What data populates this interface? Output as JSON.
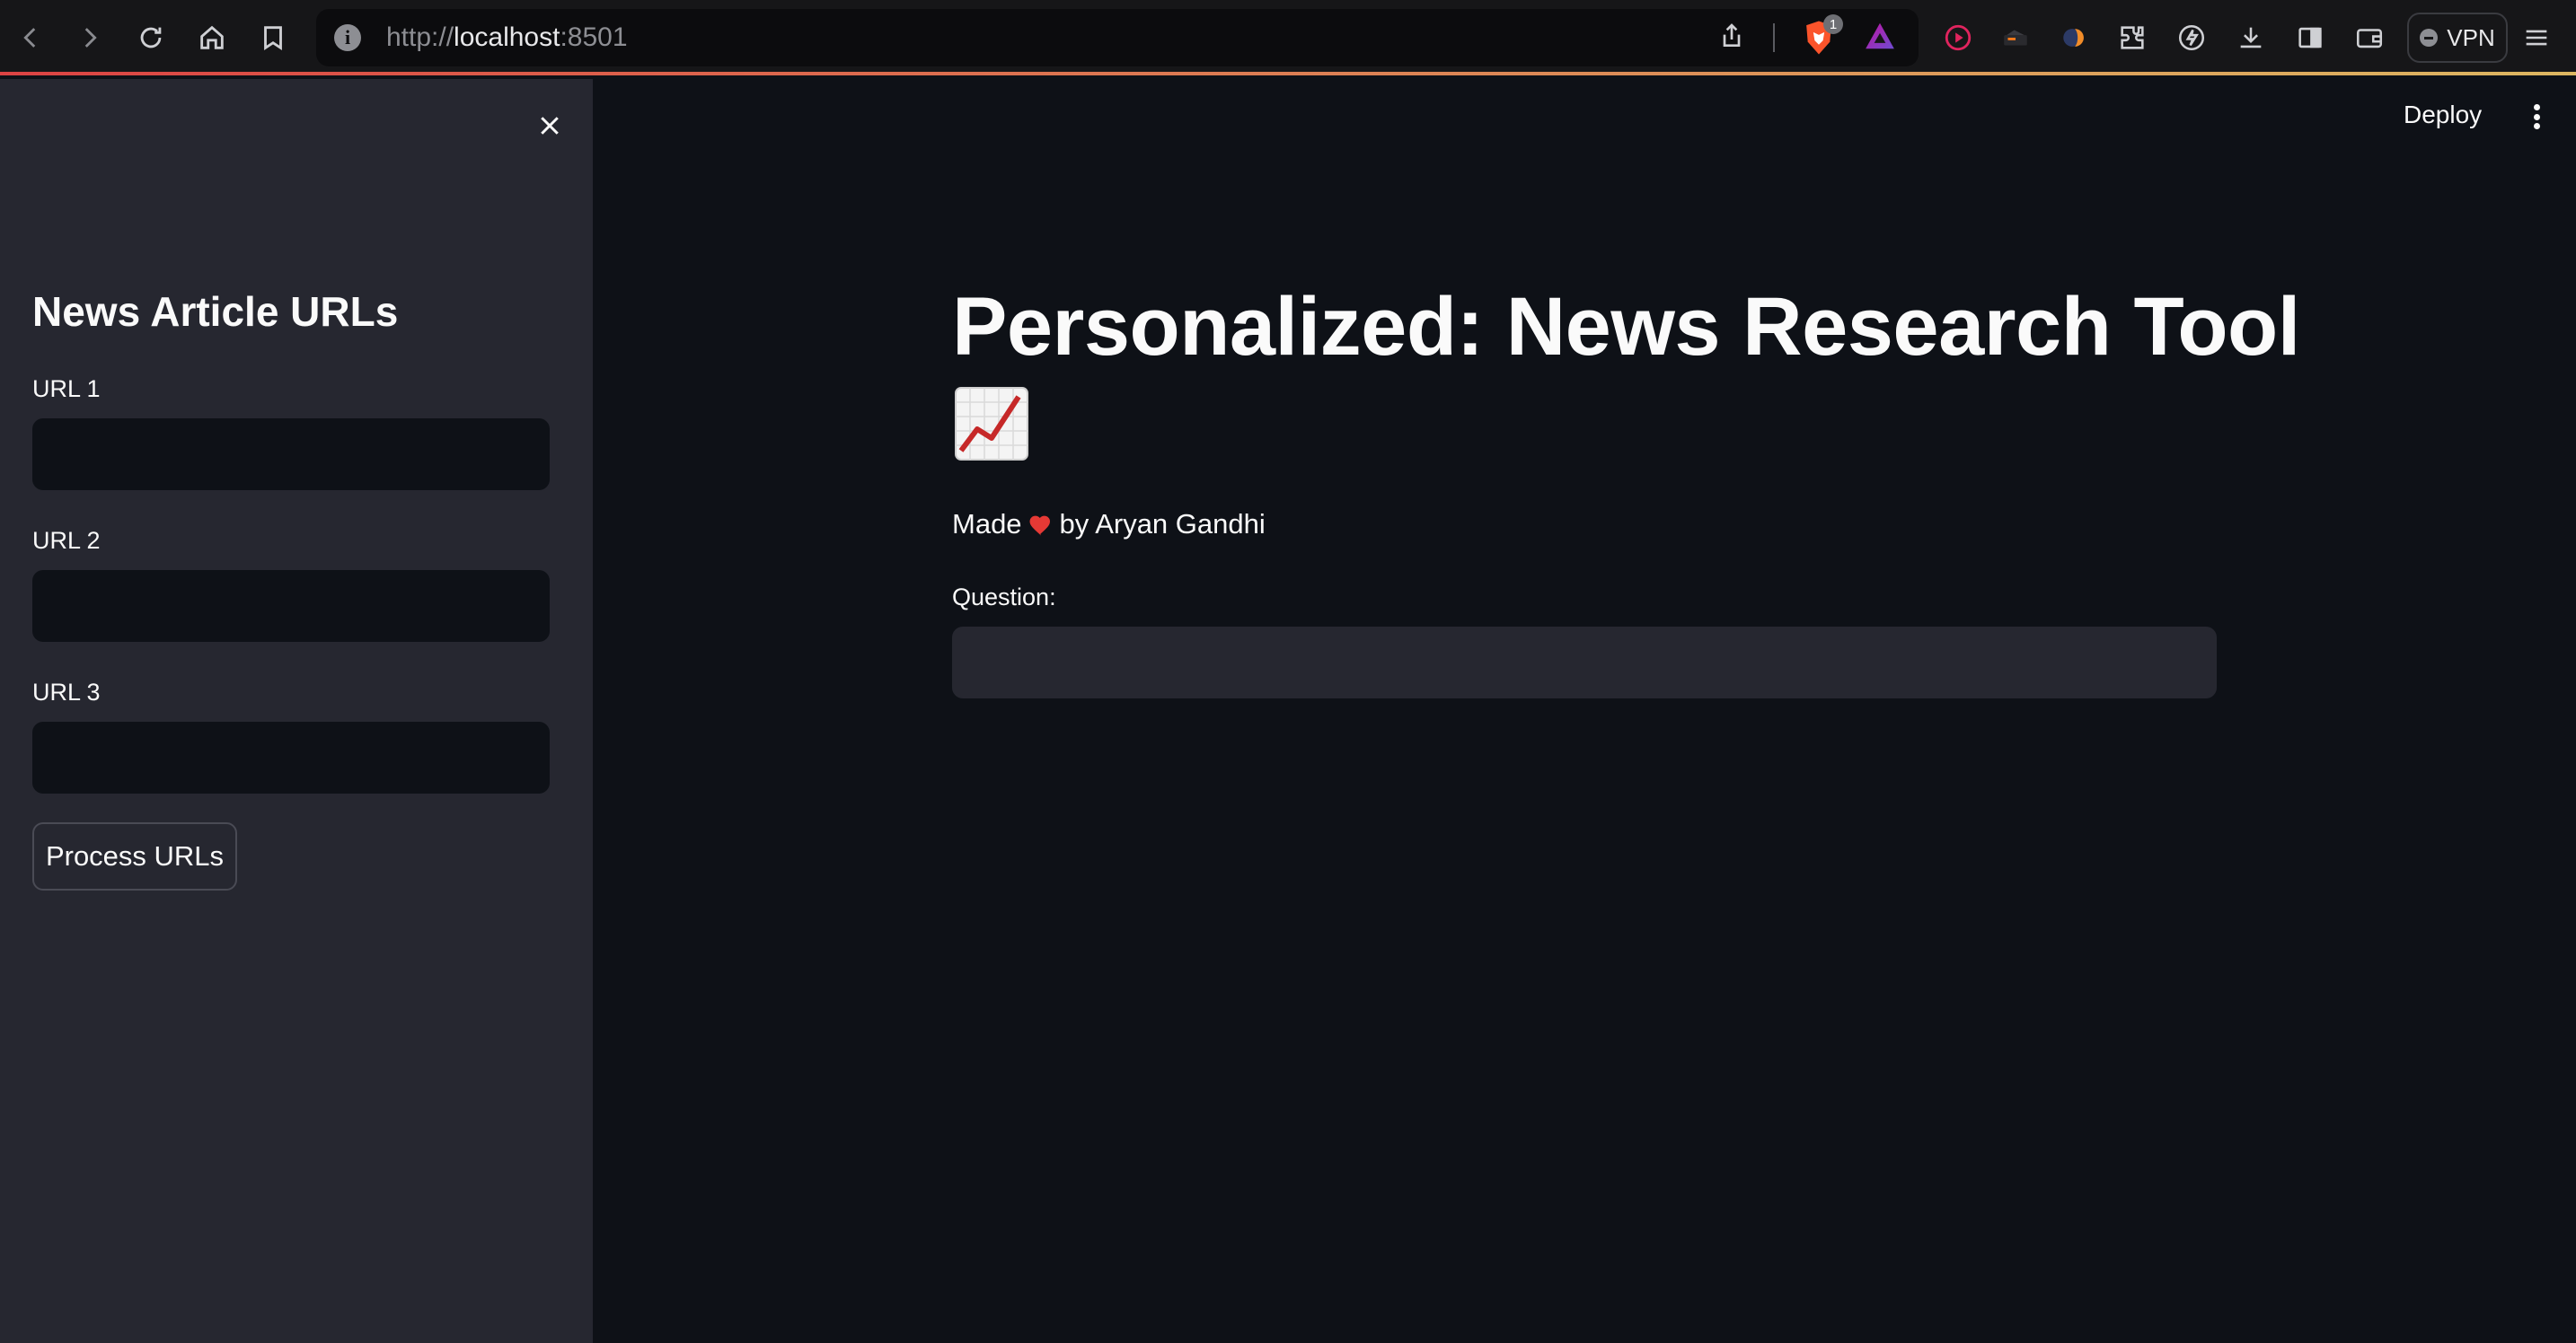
{
  "browser": {
    "url_scheme": "http://",
    "url_host": "localhost",
    "url_port": ":8501",
    "shields_badge": "1",
    "vpn_label": "VPN"
  },
  "sidebar": {
    "title": "News Article URLs",
    "fields": [
      {
        "label": "URL 1",
        "value": ""
      },
      {
        "label": "URL 2",
        "value": ""
      },
      {
        "label": "URL 3",
        "value": ""
      }
    ],
    "button_label": "Process URLs"
  },
  "header": {
    "deploy_label": "Deploy"
  },
  "main": {
    "title": "Personalized: News Research Tool",
    "title_emoji": "chart-increasing-icon",
    "made_prefix": "Made",
    "made_suffix": "by Aryan Gandhi",
    "question_label": "Question:",
    "question_value": ""
  },
  "colors": {
    "background": "#0e1117",
    "sidebar": "#262730",
    "accent": "#ff4b4b",
    "text": "#fafafa"
  }
}
